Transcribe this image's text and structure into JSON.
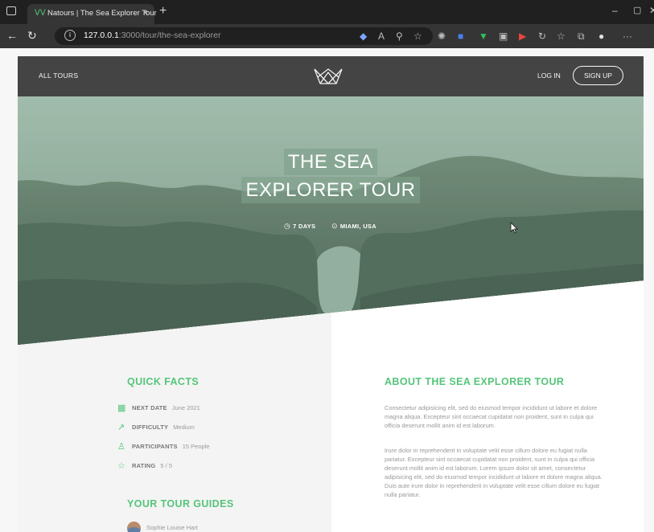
{
  "browser": {
    "tab_title": "Natours | The Sea Explorer Tour",
    "tab_close": "×",
    "new_tab": "+",
    "url_host": "127.0.0.1",
    "url_path": ":3000/tour/the-sea-explorer",
    "window_controls": {
      "minimize": "–",
      "maximize": "▢",
      "close": "✕"
    },
    "toolbar_more": "···"
  },
  "header": {
    "nav_all_tours": "ALL TOURS",
    "nav_login": "LOG IN",
    "nav_signup": "SIGN UP"
  },
  "hero": {
    "title_line1": "THE SEA",
    "title_line2": "EXPLORER TOUR",
    "duration": "7 DAYS",
    "location": "MIAMI, USA"
  },
  "quick_facts": {
    "heading": "QUICK FACTS",
    "items": [
      {
        "label": "NEXT DATE",
        "value": "June 2021",
        "icon": "calendar-icon"
      },
      {
        "label": "DIFFICULTY",
        "value": "Medium",
        "icon": "trending-up-icon"
      },
      {
        "label": "PARTICIPANTS",
        "value": "15 People",
        "icon": "user-icon"
      },
      {
        "label": "RATING",
        "value": "5 / 5",
        "icon": "star-icon"
      }
    ]
  },
  "guides": {
    "heading": "YOUR TOUR GUIDES",
    "items": [
      {
        "name": "Sophie Louise Hart"
      }
    ]
  },
  "about": {
    "heading": "ABOUT THE SEA EXPLORER TOUR",
    "paragraphs": [
      "Consectetur adipisicing elit, sed do eiusmod tempor incididunt ut labore et dolore magna aliqua. Excepteur sint occaecat cupidatat non proident, sunt in culpa qui officia deserunt mollit anim id est laborum.",
      "Irure dolor in reprehenderit in voluptate velit esse cillum dolore eu fugiat nulla pariatur. Excepteur sint occaecat cupidatat non proident, sunt in culpa qui officia deserunt mollit anim id est laborum. Lorem ipsum dolor sit amet, consectetur adipisicing elit, sed do eiusmod tempor incididunt ut labore et dolore magna aliqua. Duis aute irure dolor in reprehenderit in voluptate velit esse cillum dolore eu fugiat nulla pariatur."
    ]
  },
  "colors": {
    "accent": "#55c57a",
    "header_bg": "#444444",
    "hero_overlay": "#7ea08a"
  }
}
